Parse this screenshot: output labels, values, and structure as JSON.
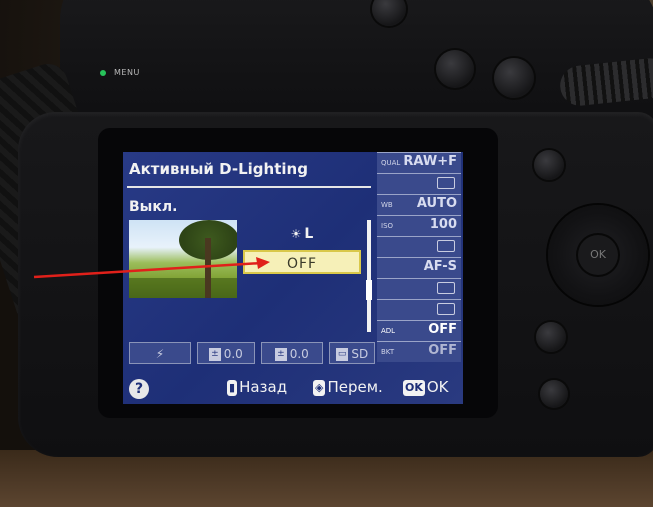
{
  "camera": {
    "menu_button_label": "MENU"
  },
  "lcd": {
    "menu_title": "Активный D-Lighting",
    "current_value": "Выкл.",
    "options": [
      {
        "label": "L",
        "icon": "adl-icon",
        "selected": false
      },
      {
        "label": "OFF",
        "selected": true
      }
    ],
    "bottom_icons": [
      {
        "name": "flash-mode",
        "glyph": "⚡",
        "value": ""
      },
      {
        "name": "flash-compensation",
        "glyph": "±",
        "value": "0.0"
      },
      {
        "name": "exposure-compensation",
        "glyph": "±",
        "value": "0.0"
      },
      {
        "name": "picture-control",
        "glyph": "▭",
        "value": "SD"
      }
    ],
    "right_panel": [
      {
        "label": "QUAL",
        "value": "RAW+F",
        "icon": "",
        "state": "normal"
      },
      {
        "label": "",
        "value": "",
        "icon": "image-size-icon",
        "state": "normal"
      },
      {
        "label": "WB",
        "value": "AUTO",
        "icon": "",
        "state": "normal"
      },
      {
        "label": "ISO",
        "value": "100",
        "icon": "",
        "state": "normal"
      },
      {
        "label": "",
        "value": "",
        "icon": "release-mode-icon",
        "state": "normal"
      },
      {
        "label": "",
        "value": "AF-S",
        "icon": "",
        "state": "normal"
      },
      {
        "label": "",
        "value": "",
        "icon": "af-area-icon",
        "state": "normal"
      },
      {
        "label": "",
        "value": "",
        "icon": "metering-icon",
        "state": "normal"
      },
      {
        "label": "ADL",
        "value": "OFF",
        "icon": "",
        "state": "active"
      },
      {
        "label": "BKT",
        "value": "OFF",
        "icon": "",
        "state": "dim"
      }
    ],
    "help": {
      "help_glyph": "?",
      "back_glyph": "MENU",
      "back_label": "Назад",
      "move_glyph": "◈",
      "move_label": "Перем.",
      "ok_glyph": "OK",
      "ok_label": "OK"
    }
  },
  "colors": {
    "lcd_background": "#1e2f77",
    "selection_fill": "#f6f0b8",
    "annotation_arrow": "#e0201a"
  }
}
